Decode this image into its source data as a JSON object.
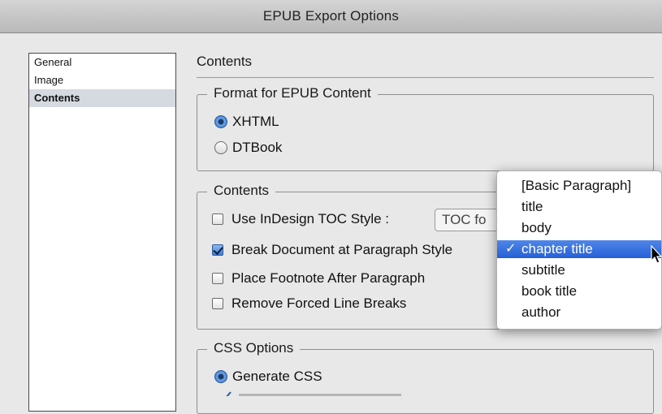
{
  "window": {
    "title": "EPUB Export Options"
  },
  "sidebar": {
    "items": [
      {
        "label": "General",
        "selected": false
      },
      {
        "label": "Image",
        "selected": false
      },
      {
        "label": "Contents",
        "selected": true
      }
    ]
  },
  "main": {
    "section_title": "Contents",
    "format_group": {
      "legend": "Format for EPUB Content",
      "options": [
        {
          "label": "XHTML",
          "selected": true
        },
        {
          "label": "DTBook",
          "selected": false
        }
      ]
    },
    "contents_group": {
      "legend": "Contents",
      "use_toc": {
        "label": "Use InDesign TOC Style :",
        "checked": false
      },
      "toc_select_value": "TOC fo",
      "break_doc": {
        "label": "Break Document at Paragraph Style",
        "checked": true
      },
      "footnote": {
        "label": "Place Footnote After Paragraph",
        "checked": false
      },
      "line_breaks": {
        "label": "Remove Forced Line Breaks",
        "checked": false
      }
    },
    "css_group": {
      "legend": "CSS Options",
      "generate": {
        "label": "Generate CSS",
        "selected": true
      }
    }
  },
  "popup_menu": {
    "items": [
      {
        "label": "[Basic Paragraph]",
        "selected": false
      },
      {
        "label": "title",
        "selected": false
      },
      {
        "label": "body",
        "selected": false
      },
      {
        "label": "chapter title",
        "selected": true
      },
      {
        "label": "subtitle",
        "selected": false
      },
      {
        "label": "book title",
        "selected": false
      },
      {
        "label": "author",
        "selected": false
      }
    ],
    "checkmark": "✓"
  },
  "colors": {
    "highlight": "#2560d6",
    "sidebar_selected": "#d5d9e0",
    "radio_on": "#3e7fd4"
  }
}
